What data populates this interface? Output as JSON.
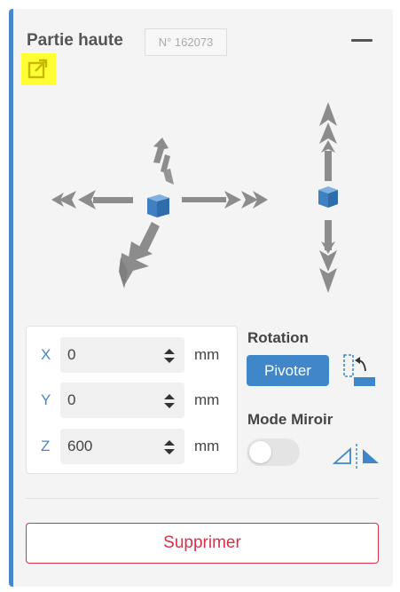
{
  "header": {
    "title": "Partie haute",
    "reference": "N° 162073",
    "collapse_icon": "minus-icon",
    "link_icon": "external-link-icon",
    "link_highlight_color": "#ffff33"
  },
  "gizmo": {
    "cube_color": "#4a86c8",
    "arrow_color": "#8c8c8c"
  },
  "coordinates": {
    "rows": [
      {
        "axis": "X",
        "value": "0",
        "unit": "mm"
      },
      {
        "axis": "Y",
        "value": "0",
        "unit": "mm"
      },
      {
        "axis": "Z",
        "value": "600",
        "unit": "mm"
      }
    ]
  },
  "rotation": {
    "label": "Rotation",
    "button_label": "Pivoter",
    "icon": "rotate-icon"
  },
  "mirror": {
    "label": "Mode Miroir",
    "enabled": false,
    "icon": "mirror-flip-icon"
  },
  "actions": {
    "delete_label": "Supprimer",
    "delete_color": "#d9304a"
  },
  "colors": {
    "accent": "#4a86c8",
    "primary_button": "#3f87c9"
  }
}
